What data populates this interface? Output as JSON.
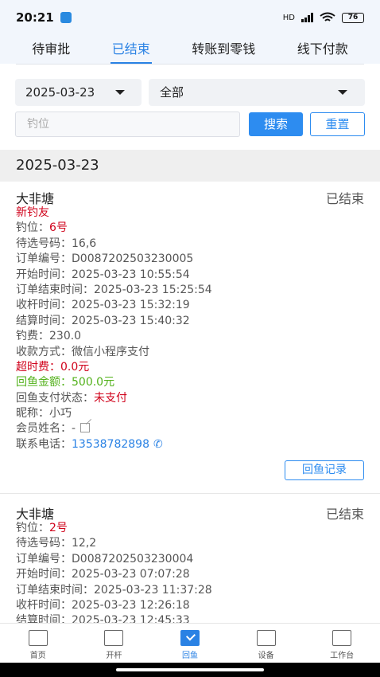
{
  "status": {
    "time": "20:21",
    "hd": "HD",
    "battery": "76"
  },
  "tabs": [
    {
      "label": "待审批"
    },
    {
      "label": "已结束"
    },
    {
      "label": "转账到零钱"
    },
    {
      "label": "线下付款"
    }
  ],
  "filters": {
    "date": "2025-03-23",
    "type": "全部",
    "search_placeholder": "钓位",
    "search_label": "搜索",
    "reset_label": "重置"
  },
  "date_group": "2025-03-23",
  "card1": {
    "pond": "大非塘",
    "status": "已结束",
    "new_angler": "新钓友",
    "rows": {
      "spot_k": "钓位：",
      "spot_v": "6号",
      "numbers_k": "待选号码：",
      "numbers_v": "16,6",
      "order_k": "订单编号：",
      "order_v": "D0087202503230005",
      "start_k": "开始时间：",
      "start_v": "2025-03-23 10:55:54",
      "end_k": "订单结束时间：",
      "end_v": "2025-03-23 15:25:54",
      "collect_k": "收杆时间：",
      "collect_v": "2025-03-23 15:32:19",
      "settle_k": "结算时间：",
      "settle_v": "2025-03-23 15:40:32",
      "fee_k": "钓费：",
      "fee_v": "230.0",
      "pay_k": "收款方式：",
      "pay_v": "微信小程序支付",
      "overtime_k": "超时费：",
      "overtime_v": "0.0元",
      "fishback_k": "回鱼金额：",
      "fishback_v": "500.0元",
      "fishback_status_k": "回鱼支付状态：",
      "fishback_status_v": "未支付",
      "nick_k": "昵称：",
      "nick_v": "小巧",
      "member_k": "会员姓名：",
      "member_v": "-",
      "phone_k": "联系电话：",
      "phone_v": "13538782898"
    },
    "record_button": "回鱼记录"
  },
  "card2": {
    "pond": "大非塘",
    "status": "已结束",
    "rows": {
      "spot_k": "钓位：",
      "spot_v": "2号",
      "numbers_k": "待选号码：",
      "numbers_v": "12,2",
      "order_k": "订单编号：",
      "order_v": "D0087202503230004",
      "start_k": "开始时间：",
      "start_v": "2025-03-23 07:07:28",
      "end_k": "订单结束时间：",
      "end_v": "2025-03-23 11:37:28",
      "collect_k": "收杆时间：",
      "collect_v": "2025-03-23 12:26:18",
      "settle_k": "结算时间：",
      "settle_v": "2025-03-23 12:45:33"
    }
  },
  "nav": [
    {
      "label": "首页",
      "icon": "home-icon"
    },
    {
      "label": "开杆",
      "icon": "list-icon"
    },
    {
      "label": "回鱼",
      "icon": "check-icon"
    },
    {
      "label": "设备",
      "icon": "device-icon"
    },
    {
      "label": "工作台",
      "icon": "monitor-icon"
    }
  ],
  "colors": {
    "accent": "#2a82e4",
    "alert": "#d0021b",
    "success": "#52b11a"
  }
}
